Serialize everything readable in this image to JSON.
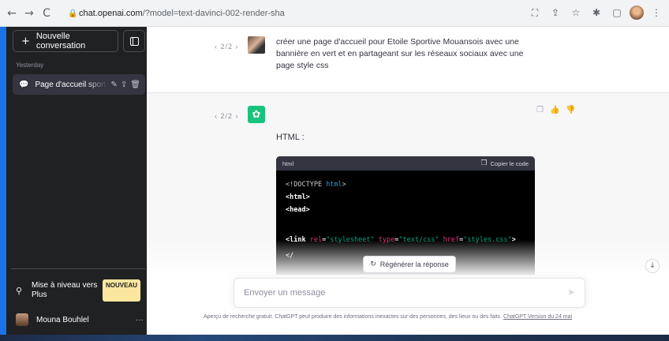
{
  "browser": {
    "url_host": "chat.openai.com",
    "url_path": "/?model=text-davinci-002-render-sha",
    "nav": {
      "back": "←",
      "forward": "→",
      "reload": "C"
    },
    "toolbar_icons": [
      "translate-icon",
      "share-icon",
      "star-icon",
      "extensions-icon",
      "sidebar-icon",
      "profile-icon",
      "menu-icon"
    ]
  },
  "sidebar": {
    "new_chat_label": "Nouvelle conversation",
    "section_label": "Yesterday",
    "conversation_title": "Page d'accueil sportive",
    "upgrade_label": "Mise à niveau vers Plus",
    "upgrade_badge": "NOUVEAU",
    "user_name": "Mouna Bouhlel",
    "user_menu": "···",
    "accent_color": "#1b73e8"
  },
  "thread": {
    "user_pager": "‹ 2/2 ›",
    "user_message": "créer une page d'accueil pour Etoile Sportive Mouansois avec une bannière en vert et en partageant sur les réseaux sociaux avec une page style css",
    "bot_pager": "‹ 2/2 ›",
    "bot_intro": "HTML :",
    "code_lang": "html",
    "copy_label": "Copier le code",
    "code_last": "</"
  },
  "controls": {
    "regenerate_label": "Régénérer la réponse",
    "input_placeholder": "Envoyer un message",
    "send_icon": "➤"
  },
  "footer": {
    "disclaimer": "Aperçu de recherche gratuit. ChatGPT peut produire des informations inexactes sur des personnes, des lieux ou des faits. ",
    "version_link": "ChatGPT Version du 24 mai"
  },
  "colors": {
    "sidebar_bg": "#202123",
    "bot_avatar": "#19c37d",
    "badge": "#fae69e"
  }
}
